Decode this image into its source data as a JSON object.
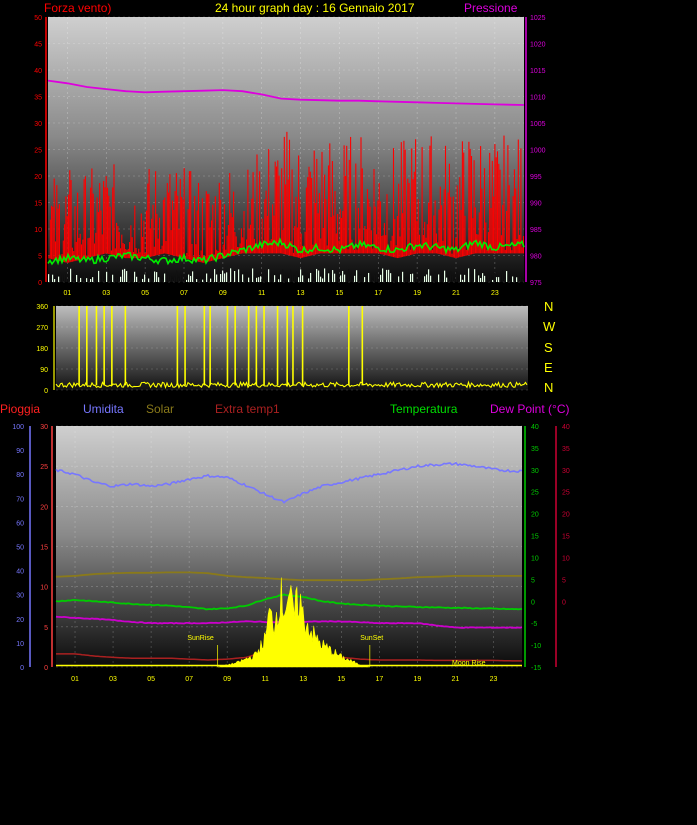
{
  "header": {
    "title": "24 hour graph day : 16 Gennaio 2017",
    "left_label": "Forza vento)",
    "right_label": "Pressione"
  },
  "direction_labels": [
    "N",
    "W",
    "S",
    "E",
    "N"
  ],
  "bottom_legend": {
    "rain": "Pioggia",
    "humidity": "Umidita",
    "solar": "Solar",
    "extra_temp": "Extra temp1",
    "temperature": "Temperatura",
    "dew_point": "Dew Point (°C)"
  },
  "annotations": {
    "sunrise": "SunRise",
    "sunset": "SunSet",
    "moonrise": "Moon Rise"
  },
  "colors": {
    "wind": "#ff0000",
    "gust": "#00ee00",
    "pressure": "#dd00dd",
    "direction": "#ffff00",
    "humidity": "#7777ff",
    "solar": "#8a7a1a",
    "extra_temp": "#aa2020",
    "temperature": "#00cc00",
    "dew_point": "#cc00cc",
    "solar_fill": "#ffff00"
  },
  "chart_data": [
    {
      "type": "line",
      "name": "wind-pressure",
      "x_ticks": [
        "01",
        "03",
        "05",
        "07",
        "09",
        "11",
        "13",
        "15",
        "17",
        "19",
        "21",
        "23"
      ],
      "xlim": [
        0,
        24.5
      ],
      "ylim_left": [
        0,
        50
      ],
      "yticks_left": [
        0,
        5,
        10,
        15,
        20,
        25,
        30,
        35,
        40,
        45,
        50
      ],
      "ylim_right": [
        975,
        1025
      ],
      "yticks_right": [
        975,
        980,
        985,
        990,
        995,
        1000,
        1005,
        1010,
        1015,
        1020,
        1025
      ],
      "grid": true,
      "series": [
        {
          "name": "Pressione",
          "axis": "right",
          "x": [
            0,
            1,
            2,
            3,
            4,
            5,
            6,
            7,
            8,
            9,
            10,
            11,
            12,
            13,
            14,
            15,
            16,
            17,
            18,
            19,
            20,
            21,
            22,
            23,
            24.5
          ],
          "values": [
            1013,
            1012.5,
            1011.8,
            1011.4,
            1011,
            1010.8,
            1010.9,
            1011,
            1011.1,
            1011.2,
            1011,
            1010.4,
            1009.6,
            1009.4,
            1009.3,
            1009.2,
            1009.2,
            1009.1,
            1009.0,
            1008.9,
            1008.8,
            1008.7,
            1008.6,
            1008.5,
            1008.4
          ]
        },
        {
          "name": "Forza vento",
          "axis": "left",
          "x": [
            0,
            1,
            2,
            3,
            4,
            5,
            6,
            7,
            8,
            9,
            10,
            11,
            12,
            13,
            14,
            15,
            16,
            17,
            18,
            19,
            20,
            21,
            22,
            23,
            24.5
          ],
          "values": [
            10,
            12,
            11,
            13,
            12,
            13,
            14,
            12,
            11,
            13,
            12,
            14,
            16,
            15,
            16,
            15,
            16,
            15,
            14,
            16,
            15,
            14,
            16,
            15,
            16
          ],
          "low": [
            5,
            4,
            5,
            6,
            5,
            5,
            6,
            5,
            4,
            5,
            6,
            6,
            6,
            5,
            6,
            6,
            6,
            6,
            5,
            6,
            6,
            5,
            6,
            6,
            6
          ],
          "high": [
            20,
            22,
            21,
            24,
            20,
            22,
            24,
            22,
            20,
            24,
            21,
            26,
            30,
            28,
            30,
            27,
            29,
            28,
            26,
            30,
            28,
            27,
            30,
            28,
            28
          ]
        },
        {
          "name": "Raffica",
          "axis": "left",
          "x": [
            0,
            1,
            2,
            3,
            4,
            5,
            6,
            7,
            8,
            9,
            10,
            11,
            12,
            13,
            14,
            15,
            16,
            17,
            18,
            19,
            20,
            21,
            22,
            23,
            24.5
          ],
          "values": [
            4,
            4.5,
            4,
            4.5,
            5,
            4.5,
            4,
            4.5,
            4,
            5,
            6,
            7,
            7.5,
            6,
            6.5,
            6,
            7,
            6.5,
            6,
            7,
            6.5,
            6,
            7.5,
            6.5,
            7
          ]
        }
      ]
    },
    {
      "type": "line",
      "name": "wind-direction",
      "xlim": [
        0,
        24.5
      ],
      "ylim": [
        0,
        360
      ],
      "yticks": [
        0,
        90,
        180,
        270,
        360
      ],
      "series": [
        {
          "name": "Direzione",
          "base": 20,
          "spikes_x": [
            1.2,
            1.6,
            2.1,
            2.5,
            2.9,
            3.6,
            6.3,
            6.7,
            7.7,
            8.0,
            8.9,
            9.3,
            10.0,
            10.4,
            10.8,
            11.5,
            12.0,
            12.3,
            12.8,
            15.2,
            15.9
          ],
          "spike_value": 360
        }
      ]
    },
    {
      "type": "area",
      "name": "weather",
      "x_ticks": [
        "01",
        "03",
        "05",
        "07",
        "09",
        "11",
        "13",
        "15",
        "17",
        "19",
        "21",
        "23"
      ],
      "xlim": [
        0,
        24.5
      ],
      "ylim_rain": [
        0,
        100
      ],
      "yticks_rain": [
        0,
        10,
        20,
        30,
        40,
        50,
        60,
        70,
        80,
        90,
        100
      ],
      "ylim_humidity": [
        0,
        30
      ],
      "yticks_humidity": [
        0,
        5,
        10,
        15,
        20,
        25,
        30
      ],
      "ylim_temp": [
        -15,
        40
      ],
      "yticks_temp": [
        -15,
        -10,
        -5,
        0,
        5,
        10,
        15,
        20,
        25,
        30,
        35,
        40
      ],
      "ylim_dew": [
        -15,
        40
      ],
      "yticks_dew": [
        0,
        5,
        10,
        15,
        20,
        25,
        30,
        35,
        40
      ],
      "series": [
        {
          "name": "Umidita",
          "axis": "humidity",
          "x": [
            0,
            1,
            2,
            3,
            4,
            5,
            6,
            7,
            8,
            9,
            10,
            11,
            12,
            13,
            14,
            15,
            16,
            17,
            18,
            19,
            20,
            21,
            22,
            23,
            24
          ],
          "values": [
            24.5,
            24,
            23,
            22.5,
            22.8,
            22.5,
            22.8,
            23.4,
            23.8,
            23.6,
            22.6,
            21.5,
            20.5,
            21.6,
            22.5,
            23,
            23.5,
            24,
            24.5,
            25,
            25.2,
            25.3,
            25,
            24.6,
            24.4
          ]
        },
        {
          "name": "Solar",
          "axis": "temp",
          "x": [
            0,
            1,
            2,
            3,
            4,
            5,
            6,
            7,
            8,
            9,
            10,
            11,
            12,
            13,
            14,
            15,
            16,
            17,
            18,
            19,
            20,
            21,
            22,
            23,
            24
          ],
          "values": [
            5.6,
            5.8,
            6.2,
            6.4,
            6.5,
            6.5,
            6.6,
            6.6,
            6.4,
            5.8,
            5.5,
            5.3,
            5.0,
            4.8,
            4.8,
            4.8,
            4.8,
            5.0,
            5.2,
            5.5,
            5.6,
            5.8,
            5.8,
            5.8,
            5.8
          ]
        },
        {
          "name": "Temperatura",
          "axis": "temp",
          "x": [
            0,
            1,
            2,
            3,
            4,
            5,
            6,
            7,
            8,
            9,
            10,
            11,
            12,
            13,
            14,
            15,
            16,
            17,
            18,
            19,
            20,
            21,
            22,
            23,
            24
          ],
          "values": [
            0,
            0.3,
            0,
            -0.3,
            -0.6,
            -0.8,
            -1,
            -1.4,
            -1.8,
            -1.6,
            -1,
            0.5,
            1.5,
            1,
            0,
            -0.5,
            -0.8,
            -1,
            -1.2,
            -1.3,
            -1.4,
            -1.5,
            -1.6,
            -1.7,
            -1.8
          ]
        },
        {
          "name": "Dew Point",
          "axis": "temp",
          "x": [
            0,
            1,
            2,
            3,
            4,
            5,
            6,
            7,
            8,
            9,
            10,
            11,
            12,
            13,
            14,
            15,
            16,
            17,
            18,
            19,
            20,
            21,
            22,
            23,
            24
          ],
          "values": [
            -3.5,
            -3.8,
            -4,
            -4.3,
            -4.7,
            -5,
            -5,
            -5,
            -5,
            -4.8,
            -4.6,
            -4.7,
            -4.8,
            -4.7,
            -4.6,
            -4.6,
            -4.8,
            -5,
            -5,
            -5,
            -5.5,
            -6,
            -6,
            -6,
            -6
          ]
        },
        {
          "name": "Extra temp1",
          "axis": "temp",
          "x": [
            0,
            1,
            2,
            3,
            4,
            5,
            6,
            7,
            8,
            9,
            10,
            11,
            12,
            13,
            14,
            15,
            16,
            17,
            18,
            19,
            20,
            21,
            22,
            23,
            24
          ],
          "values": [
            -12,
            -12,
            -12.5,
            -12.8,
            -13,
            -13,
            -13,
            -13.2,
            -13.4,
            -13.2,
            -12.8,
            -11.5,
            -11,
            -11.2,
            -12,
            -12.8,
            -13.2,
            -13.4,
            -13.4,
            -13.4,
            -13.5,
            -13.5,
            -13.5,
            -13.5,
            -13.6
          ]
        },
        {
          "name": "Solar radiation",
          "axis": "rain",
          "x": [
            8.5,
            9,
            9.5,
            10,
            10.5,
            11,
            11.2,
            11.5,
            11.8,
            12,
            12.2,
            12.5,
            12.8,
            13,
            13.3,
            13.6,
            14,
            14.5,
            15,
            15.5,
            16,
            16.5
          ],
          "values": [
            0,
            1,
            2,
            4,
            6,
            14,
            26,
            22,
            36,
            30,
            37,
            26,
            35,
            24,
            20,
            15,
            11,
            8,
            5,
            3,
            1,
            0
          ]
        }
      ]
    }
  ]
}
